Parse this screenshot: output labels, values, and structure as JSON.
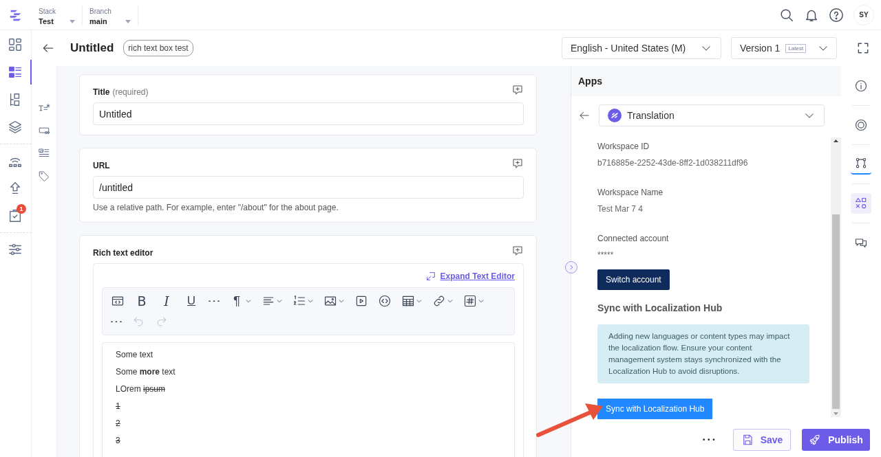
{
  "topbar": {
    "switchers": [
      {
        "label": "Stack",
        "value": "Test"
      },
      {
        "label": "Branch",
        "value": "main"
      }
    ],
    "avatar": "SY"
  },
  "rail": {
    "groups": [
      [
        {
          "kind": "dashboard",
          "selected": false
        },
        {
          "kind": "entries",
          "selected": true
        },
        {
          "kind": "models",
          "selected": false
        },
        {
          "kind": "assets",
          "selected": false
        }
      ],
      [
        {
          "kind": "releases",
          "selected": false
        },
        {
          "kind": "deploy",
          "selected": false
        },
        {
          "kind": "tasks",
          "selected": false,
          "badge": "1"
        }
      ],
      [
        {
          "kind": "settings",
          "selected": false
        }
      ]
    ]
  },
  "header": {
    "title": "Untitled",
    "tag": "rich text box test",
    "locale": "English - United States (M)",
    "version": "Version 1",
    "version_badge": "Latest"
  },
  "field_nav": [
    {
      "kind": "text"
    },
    {
      "kind": "link"
    },
    {
      "kind": "rte"
    },
    {
      "kind": "tags"
    }
  ],
  "fields": [
    {
      "kind": "text",
      "label": "Title",
      "note": "(required)",
      "value": "Untitled"
    },
    {
      "kind": "text",
      "label": "URL",
      "value": "/untitled",
      "help": "Use a relative path. For example, enter \"/about\" for the about page."
    },
    {
      "kind": "rte",
      "label": "Rich text editor",
      "expand_link": "Expand Text Editor",
      "toolbar_rows": [
        [
          {
            "kind": "source",
            "dropdown": false,
            "disabled": false
          },
          {
            "kind": "bold",
            "glyph": "B",
            "dropdown": false,
            "disabled": false
          },
          {
            "kind": "italic",
            "glyph": "I",
            "dropdown": false,
            "disabled": false
          },
          {
            "kind": "underline",
            "glyph": "U",
            "dropdown": false,
            "disabled": false
          },
          {
            "kind": "more",
            "dropdown": false,
            "disabled": false
          },
          {
            "kind": "paragraph",
            "glyph": "¶",
            "dropdown": true,
            "disabled": false
          },
          {
            "kind": "align",
            "dropdown": true,
            "disabled": false
          },
          {
            "kind": "list",
            "dropdown": true,
            "disabled": false
          },
          {
            "kind": "image",
            "dropdown": true,
            "disabled": false
          },
          {
            "kind": "video",
            "dropdown": false,
            "disabled": false
          },
          {
            "kind": "embed",
            "dropdown": false,
            "disabled": false
          },
          {
            "kind": "table",
            "dropdown": true,
            "disabled": false
          },
          {
            "kind": "link",
            "dropdown": true,
            "disabled": false
          },
          {
            "kind": "hash",
            "dropdown": true,
            "disabled": false
          }
        ],
        [
          {
            "kind": "more",
            "dropdown": false,
            "disabled": false
          },
          {
            "kind": "undo",
            "dropdown": false,
            "disabled": true
          },
          {
            "kind": "redo",
            "dropdown": false,
            "disabled": true
          }
        ]
      ],
      "paragraphs": [
        {
          "runs": [
            {
              "text": "Some text",
              "struck": false
            }
          ]
        },
        {
          "runs": [
            {
              "text": "Some **more** text",
              "struck": false
            }
          ]
        },
        {
          "runs": [
            {
              "text": "LOrem ",
              "struck": false
            },
            {
              "text": "ipsum ",
              "struck": true
            }
          ]
        },
        {
          "runs": [
            {
              "text": "1",
              "struck": true
            }
          ]
        },
        {
          "runs": [
            {
              "text": "2",
              "struck": true
            }
          ]
        },
        {
          "runs": [
            {
              "text": "3",
              "struck": true
            }
          ]
        }
      ]
    }
  ],
  "apps_panel": {
    "title": "Apps",
    "app": "Translation",
    "fields": [
      {
        "label": "Workspace ID",
        "value": "b716885e-2252-43de-8ff2-1d038211df96"
      },
      {
        "label": "Workspace Name",
        "value": "Test Mar 7 4"
      },
      {
        "label": "Connected account",
        "value": "*****"
      }
    ],
    "switch_button": "Switch account",
    "sync_heading": "Sync with Localization Hub",
    "notice": "Adding new languages or content types may impact the localization flow. Ensure your content management system stays synchronized with the Localization Hub to avoid disruptions.",
    "sync_button": "Sync with Localization Hub"
  },
  "side_tools": [
    {
      "kind": "info",
      "selected": false,
      "underlined": false
    },
    {
      "kind": "target",
      "selected": false,
      "underlined": false
    },
    {
      "kind": "connector",
      "selected": false,
      "underlined": true
    },
    {
      "kind": "apps",
      "selected": true,
      "underlined": false
    },
    {
      "kind": "chat",
      "selected": false,
      "underlined": false
    }
  ],
  "footer": {
    "save": "Save",
    "publish": "Publish"
  }
}
